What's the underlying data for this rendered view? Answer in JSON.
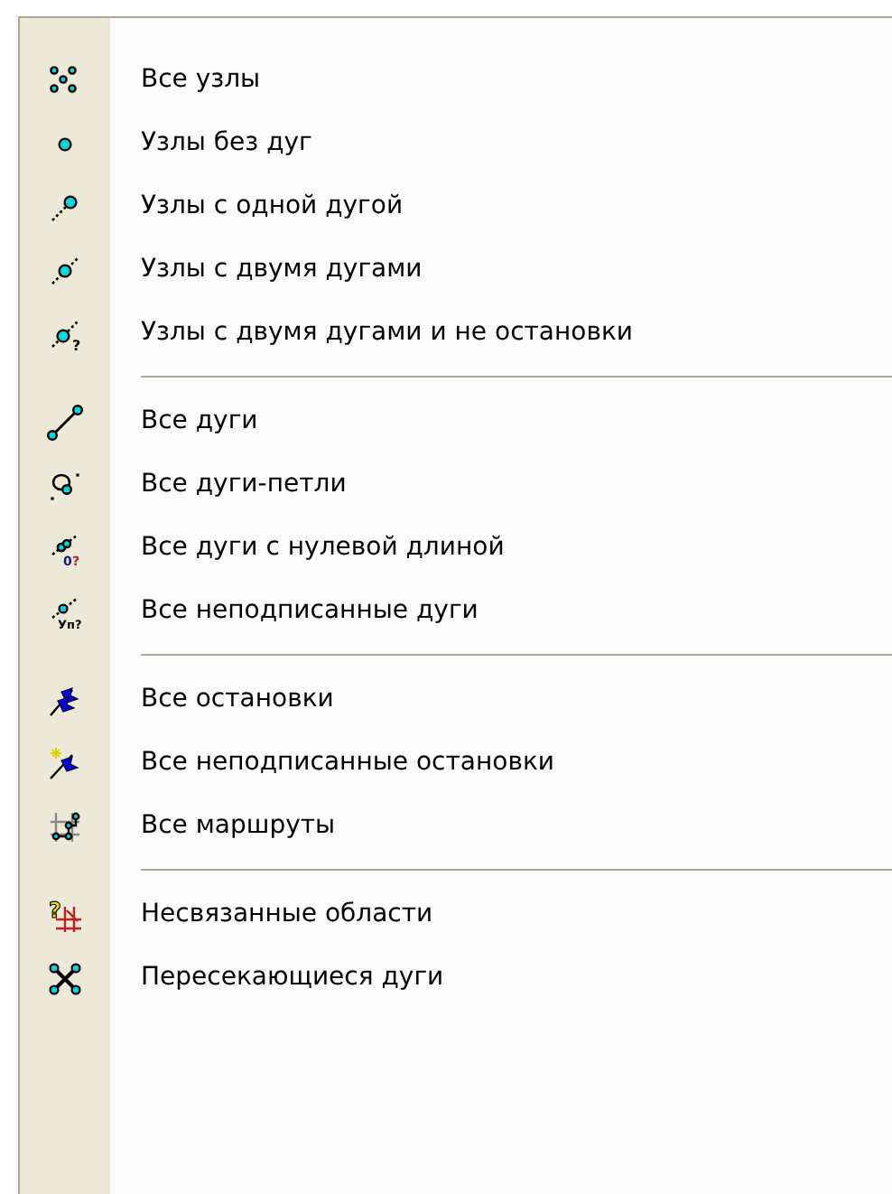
{
  "menu": {
    "groups": [
      {
        "items": [
          {
            "label": "Все узлы"
          },
          {
            "label": "Узлы без дуг"
          },
          {
            "label": "Узлы с одной дугой"
          },
          {
            "label": "Узлы с двумя дугами"
          },
          {
            "label": "Узлы с двумя дугами и не остановки",
            "icon_marks": [
              "?"
            ]
          }
        ]
      },
      {
        "items": [
          {
            "label": "Все дуги"
          },
          {
            "label": "Все дуги-петли"
          },
          {
            "label": "Все дуги с нулевой длиной",
            "icon_marks": [
              "0",
              "?"
            ]
          },
          {
            "label": "Все неподписанные дуги",
            "icon_marks": [
              "Уп?"
            ]
          }
        ]
      },
      {
        "items": [
          {
            "label": "Все остановки"
          },
          {
            "label": "Все неподписанные остановки"
          },
          {
            "label": "Все маршруты"
          }
        ]
      },
      {
        "items": [
          {
            "label": "Несвязанные области",
            "icon_marks": [
              "?"
            ]
          },
          {
            "label": "Пересекающиеся дуги"
          }
        ]
      }
    ]
  }
}
